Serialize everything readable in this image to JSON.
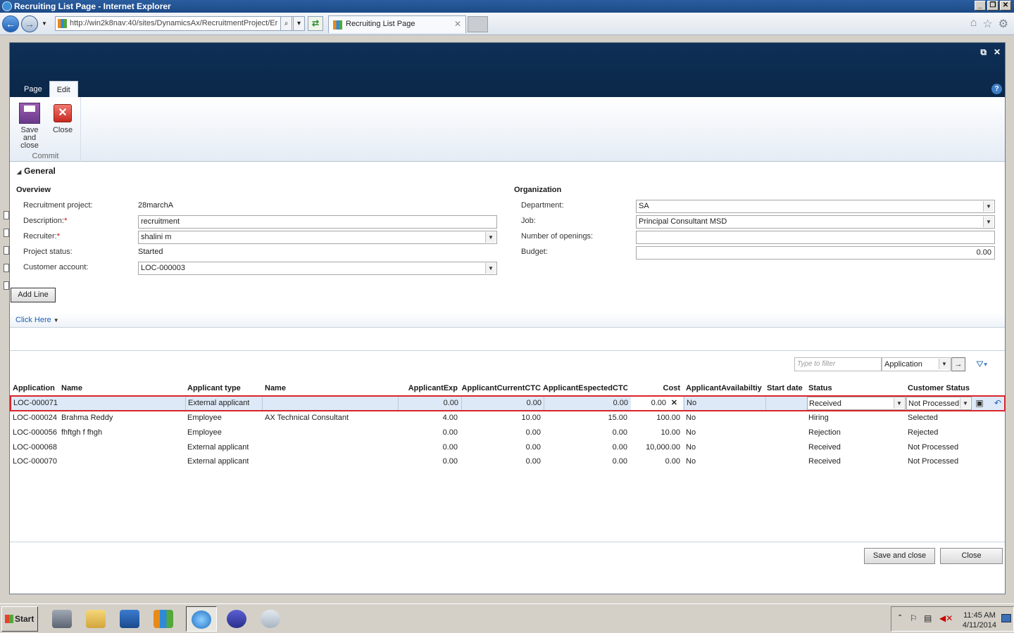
{
  "browser": {
    "window_title": "Recruiting List Page - Internet Explorer",
    "url": "http://win2k8nav:40/sites/DynamicsAx/RecruitmentProject/Er",
    "tab_title": "Recruiting List Page"
  },
  "ribbon": {
    "tabs": [
      "Page",
      "Edit"
    ],
    "save_close_label": "Save and close",
    "close_label": "Close",
    "group_label": "Commit"
  },
  "general": {
    "section_title": "General",
    "overview_title": "Overview",
    "organization_title": "Organization",
    "recruitment_project_label": "Recruitment project:",
    "recruitment_project_value": "28marchA",
    "description_label": "Description:",
    "description_value": "recruitment",
    "recruiter_label": "Recruiter:",
    "recruiter_value": "shalini m",
    "project_status_label": "Project status:",
    "project_status_value": "Started",
    "customer_account_label": "Customer account:",
    "customer_account_value": "LOC-000003",
    "department_label": "Department:",
    "department_value": "SA",
    "job_label": "Job:",
    "job_value": "Principal Consultant MSD",
    "openings_label": "Number of openings:",
    "openings_value": "",
    "budget_label": "Budget:",
    "budget_value": "0.00",
    "required_marker": "*"
  },
  "actions": {
    "add_line": "Add Line",
    "click_here": "Click Here"
  },
  "filter": {
    "placeholder": "Type to filter",
    "field": "Application",
    "go": "→"
  },
  "grid": {
    "headers": [
      "Application",
      "Name",
      "Applicant type",
      "Name",
      "ApplicantExp",
      "ApplicantCurrentCTC",
      "ApplicantEspectedCTC",
      "Cost",
      "ApplicantAvailabiltiy",
      "Start date",
      "Status",
      "Customer Status"
    ],
    "selected_row": {
      "application": "LOC-000071",
      "name": "",
      "applicant_type": "External applicant",
      "name2": "",
      "exp": "0.00",
      "current_ctc": "0.00",
      "expected_ctc": "0.00",
      "cost": "0.00",
      "availability": "No",
      "start_date": "",
      "status": "Received",
      "customer_status": "Not Processed"
    },
    "rows": [
      {
        "application": "LOC-000024",
        "name": "Brahma Reddy",
        "applicant_type": "Employee",
        "name2": "AX Technical Consultant",
        "exp": "4.00",
        "current_ctc": "10.00",
        "expected_ctc": "15.00",
        "cost": "100.00",
        "availability": "No",
        "start_date": "",
        "status": "Hiring",
        "customer_status": "Selected"
      },
      {
        "application": "LOC-000056",
        "name": "fhftgh f fhgh",
        "applicant_type": "Employee",
        "name2": "",
        "exp": "0.00",
        "current_ctc": "0.00",
        "expected_ctc": "0.00",
        "cost": "10.00",
        "availability": "No",
        "start_date": "",
        "status": "Rejection",
        "customer_status": "Rejected"
      },
      {
        "application": "LOC-000068",
        "name": "",
        "applicant_type": "External applicant",
        "name2": "",
        "exp": "0.00",
        "current_ctc": "0.00",
        "expected_ctc": "0.00",
        "cost": "10,000.00",
        "availability": "No",
        "start_date": "",
        "status": "Received",
        "customer_status": "Not Processed"
      },
      {
        "application": "LOC-000070",
        "name": "",
        "applicant_type": "External applicant",
        "name2": "",
        "exp": "0.00",
        "current_ctc": "0.00",
        "expected_ctc": "0.00",
        "cost": "0.00",
        "availability": "No",
        "start_date": "",
        "status": "Received",
        "customer_status": "Not Processed"
      }
    ]
  },
  "footer": {
    "save_close": "Save and close",
    "close": "Close"
  },
  "taskbar": {
    "start": "Start",
    "time": "11:45 AM",
    "date": "4/11/2014"
  }
}
